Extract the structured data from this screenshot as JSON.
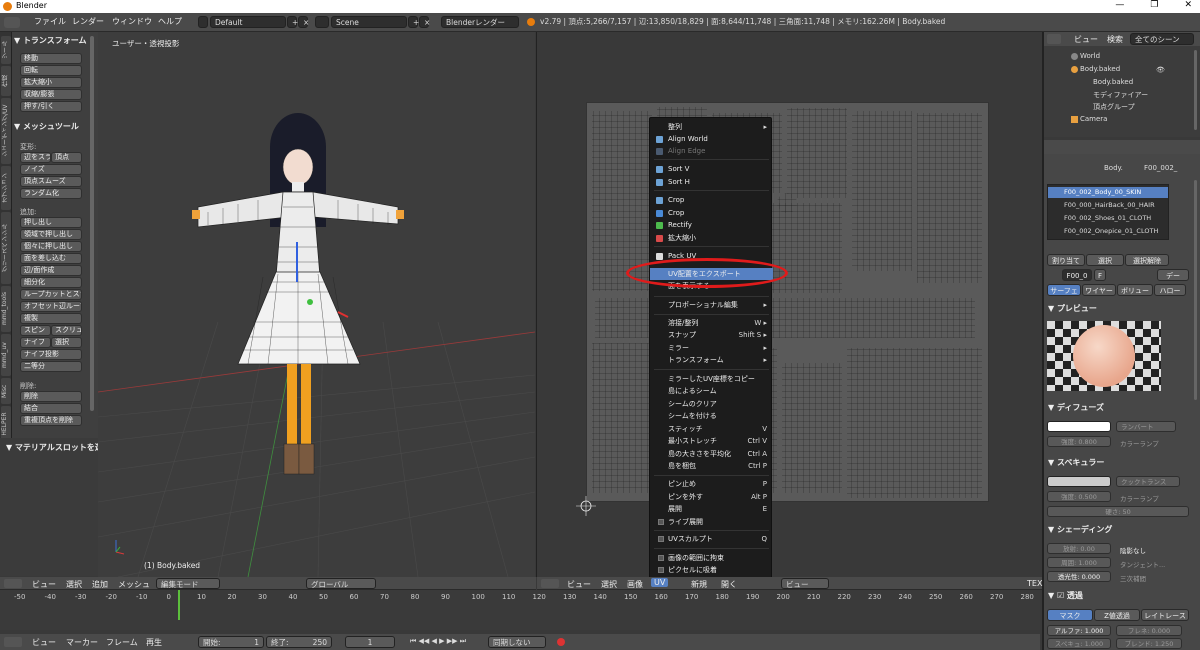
{
  "window": {
    "title": "Blender",
    "controls": [
      "—",
      "❐",
      "✕"
    ]
  },
  "topbar": {
    "menus": [
      "ファイル",
      "レンダー",
      "ウィンドウ",
      "ヘルプ"
    ],
    "layout": "Default",
    "scene": "Scene",
    "engine": "Blenderレンダー",
    "stats": "v2.79 | 頂点:5,266/7,157 | 辺:13,850/18,829 | 面:8,644/11,748 | 三角面:11,748 | メモリ:162.26M | Body.baked"
  },
  "toolshelf": {
    "tabs": [
      "ツール",
      "作成",
      "シェーディング/UV",
      "オプション",
      "グリースペンシル",
      "mmd_tools",
      "mmd_uv",
      "Misc",
      "VRM HELPER"
    ],
    "transform_title": "▼ トランスフォーム",
    "transform": [
      "移動",
      "回転",
      "拡大縮小",
      "収縮/膨張",
      "押す/引く"
    ],
    "meshtools_title": "▼ メッシュツール",
    "deform_label": "変形:",
    "deform": [
      "辺をスライド",
      "頂点",
      "ノイズ",
      "頂点スムーズ",
      "ランダム化"
    ],
    "add_label": "追加:",
    "add": [
      "押し出し",
      "領域で押し出し",
      "個々に押し出し",
      "面を差し込む",
      "辺/面作成",
      "細分化",
      "ループカットとスライド",
      "オフセット辺ループ",
      "複製",
      "スピン",
      "スクリュー",
      "ナイフ",
      "選択",
      "ナイフ投影",
      "二等分"
    ],
    "remove_label": "削除:",
    "remove": [
      "削除",
      "結合",
      "重複頂点を削除"
    ],
    "material_title": "▼ マテリアルスロットを選"
  },
  "view3d": {
    "label": "ユーザー・透視投影",
    "object": "(1) Body.baked",
    "header": [
      "ビュー",
      "選択",
      "追加",
      "メッシュ",
      "編集モード",
      "グローバル"
    ]
  },
  "uv_header": [
    "ビュー",
    "選択",
    "画像",
    "UV",
    "新規",
    "開く",
    "ビュー",
    "TEX"
  ],
  "uv_menu": [
    {
      "label": "整列",
      "sub": true
    },
    {
      "label": "Align World",
      "icon": true
    },
    {
      "label": "Align Edge",
      "icon": true,
      "disabled": true
    },
    "sep",
    {
      "label": "Sort V",
      "icon": true
    },
    {
      "label": "Sort H",
      "icon": true
    },
    "sep",
    {
      "label": "Crop",
      "icon": true
    },
    {
      "label": "Crop",
      "icon": true
    },
    {
      "label": "Rectify",
      "icon": true
    },
    {
      "label": "拡大縮小",
      "icon": true
    },
    "sep",
    {
      "label": "Pack UV",
      "icon": true
    },
    {
      "label": "UV配置をエクスポート",
      "highlight": true
    },
    {
      "label": "面を表示する"
    },
    "sep",
    {
      "label": "プロポーショナル編集",
      "sub": true
    },
    "sep",
    {
      "label": "溶接/整列",
      "shortcut": "W ▸"
    },
    {
      "label": "スナップ",
      "shortcut": "Shift S ▸"
    },
    {
      "label": "ミラー",
      "sub": true
    },
    {
      "label": "トランスフォーム",
      "sub": true
    },
    "sep",
    {
      "label": "ミラーしたUV座標をコピー"
    },
    {
      "label": "島によるシーム"
    },
    {
      "label": "シームのクリア"
    },
    {
      "label": "シームを付ける"
    },
    {
      "label": "スティッチ",
      "shortcut": "V"
    },
    {
      "label": "最小ストレッチ",
      "shortcut": "Ctrl V"
    },
    {
      "label": "島の大きさを平均化",
      "shortcut": "Ctrl A"
    },
    {
      "label": "島を梱包",
      "shortcut": "Ctrl P"
    },
    "sep",
    {
      "label": "ピン止め",
      "shortcut": "P"
    },
    {
      "label": "ピンを外す",
      "shortcut": "Alt P"
    },
    {
      "label": "展開",
      "shortcut": "E"
    },
    {
      "label": "ライブ展開",
      "check": true
    },
    "sep",
    {
      "label": "UVスカルプト",
      "check": true,
      "shortcut": "Q"
    },
    "sep",
    {
      "label": "画像の範囲に拘束",
      "check": true
    },
    {
      "label": "ピクセルに吸着",
      "check": true
    }
  ],
  "outliner": {
    "tabs": [
      "ビュー",
      "検索",
      "全てのシーン"
    ],
    "items": [
      "World",
      "Body.baked",
      "Body.baked",
      "モディファイアー",
      "頂点グループ",
      "Camera"
    ]
  },
  "properties": {
    "breadcrumb": [
      "Body.",
      "F00_002_"
    ],
    "materials": [
      "F00_002_Body_00_SKIN",
      "F00_000_HairBack_00_HAIR",
      "F00_002_Shoes_01_CLOTH",
      "F00_002_Onepice_01_CLOTH"
    ],
    "mat_buttons": [
      "割り当て",
      "選択",
      "選択解除"
    ],
    "mat_name": "F00_0",
    "mat_f": "F",
    "mat_data": "デー",
    "tabs": [
      "サーフェ",
      "ワイヤー",
      "ボリュー",
      "ハロー"
    ],
    "preview": "▼ プレビュー",
    "diffuse": "▼ ディフューズ",
    "diffuse_shader": "ランバート",
    "diffuse_intensity": "強度:    0.800",
    "ramp": "カラーランプ",
    "specular": "▼ スペキュラー",
    "spec_shader": "クックトランス",
    "spec_intensity": "強度:    0.500",
    "hardness": "硬さ:          50",
    "shading": "▼ シェーディング",
    "emit": "放射:    0.00",
    "shadeless": "陰影なし",
    "ambient": "周囲:    1.000",
    "tangent": "タンジェント...",
    "translucency": "透光性:   0.000",
    "cubic": "三次補間",
    "transparency": "▼ ☑ 透過",
    "trans_modes": [
      "マスク",
      "Z値透過",
      "レイトレース"
    ],
    "alpha": "アルファ: 1.000",
    "fresnel": "フレネ:   0.000",
    "spec_alpha": "スペキュ: 1.000",
    "blend": "ブレンド: 1.250"
  },
  "timeline": {
    "ticks": [
      "-50",
      "-40",
      "-30",
      "-20",
      "-10",
      "0",
      "10",
      "20",
      "30",
      "40",
      "50",
      "60",
      "70",
      "80",
      "90",
      "100",
      "110",
      "120",
      "130",
      "140",
      "150",
      "160",
      "170",
      "180",
      "190",
      "200",
      "210",
      "220",
      "230",
      "240",
      "250",
      "260",
      "270",
      "280"
    ],
    "current_frame": 1
  },
  "bottombar": {
    "menus": [
      "ビュー",
      "マーカー",
      "フレーム",
      "再生"
    ],
    "start": "開始:",
    "start_val": "1",
    "end": "終了:",
    "end_val": "250",
    "frame": "1",
    "sync": "同期しない"
  }
}
